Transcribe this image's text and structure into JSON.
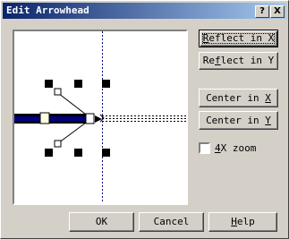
{
  "window": {
    "title": "Edit Arrowhead",
    "help_glyph": "?",
    "close_glyph": "X"
  },
  "buttons": {
    "reflect_x": {
      "pre": "",
      "key": "R",
      "post": "eflect in X"
    },
    "reflect_y": {
      "pre": "Re",
      "key": "f",
      "post": "lect in Y"
    },
    "center_x": {
      "pre": "Center in ",
      "key": "X",
      "post": ""
    },
    "center_y": {
      "pre": "Center in ",
      "key": "Y",
      "post": ""
    },
    "ok": "OK",
    "cancel": "Cancel",
    "help": {
      "pre": "",
      "key": "H",
      "post": "elp"
    }
  },
  "zoom_checkbox": {
    "key": "4",
    "rest": "X zoom",
    "checked": false
  },
  "colors": {
    "title_start": "#0a246a",
    "title_end": "#a6caf0",
    "face": "#d4d0c8",
    "shaft": "#000080"
  }
}
